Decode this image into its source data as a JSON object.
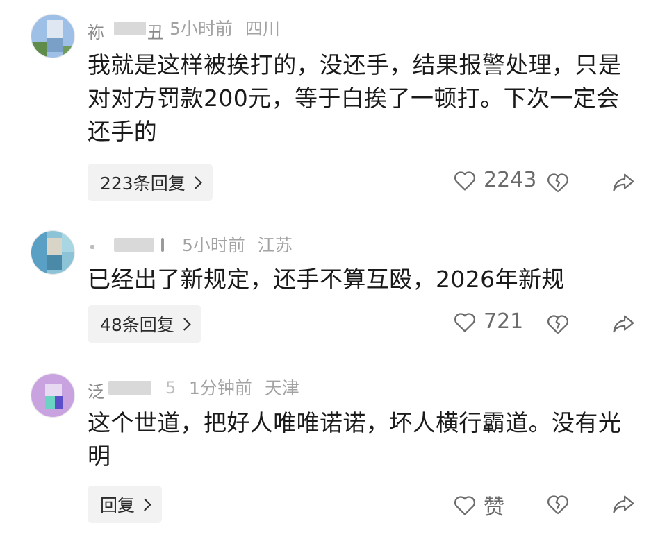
{
  "comments": [
    {
      "name_first": "袮",
      "name_last": "丑",
      "time": "5小时前",
      "location": "四川",
      "text": "我就是这样被挨打的，没还手，结果报警处理，只是对对方罚款200元，等于白挨了一顿打。下次一定会还手的",
      "reply_label": "223条回复",
      "likes": "2243",
      "avatar_colors": [
        "#9fc0e6",
        "#7aa0c8",
        "#5f8c4a",
        "#dfe8f2"
      ]
    },
    {
      "name_first": "",
      "name_last": "",
      "time": "5小时前",
      "location": "江苏",
      "text": "已经出了新规定，还手不算互殴，2026年新规",
      "reply_label": "48条回复",
      "likes": "721",
      "avatar_colors": [
        "#5a9fc4",
        "#8cc3d6",
        "#d9d4c8",
        "#4a8aa8"
      ]
    },
    {
      "name_first": "泛",
      "name_last": "5",
      "time": "1分钟前",
      "location": "天津",
      "text": "这个世道，把好人唯唯诺诺，坏人横行霸道。没有光明",
      "reply_label": "回复",
      "likes": "赞",
      "avatar_colors": [
        "#c9a3e0",
        "#6ad3c2",
        "#5a4fc8",
        "#e8d9f2"
      ]
    }
  ],
  "icons": {
    "like": "heart-outline-icon",
    "dislike": "broken-heart-icon",
    "share": "share-arrow-icon"
  },
  "colors": {
    "meta": "#a3a3a3",
    "text": "#1a1a1a",
    "reply_bg": "#f2f2f2",
    "icon": "#6b6b6b"
  }
}
